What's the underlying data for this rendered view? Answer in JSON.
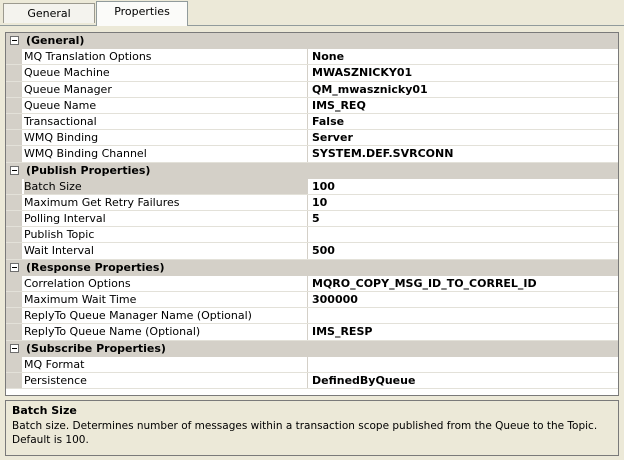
{
  "tabs": [
    {
      "label": "General"
    },
    {
      "label": "Properties"
    }
  ],
  "sections": [
    {
      "title": "(General)",
      "props": [
        {
          "name": "MQ Translation Options",
          "value": "None"
        },
        {
          "name": "Queue Machine",
          "value": "MWASZNICKY01"
        },
        {
          "name": "Queue Manager",
          "value": "QM_mwasznicky01"
        },
        {
          "name": "Queue Name",
          "value": "IMS_REQ"
        },
        {
          "name": "Transactional",
          "value": "False"
        },
        {
          "name": "WMQ Binding",
          "value": "Server"
        },
        {
          "name": "WMQ Binding Channel",
          "value": "SYSTEM.DEF.SVRCONN"
        }
      ]
    },
    {
      "title": "(Publish Properties)",
      "props": [
        {
          "name": "Batch Size",
          "value": "100"
        },
        {
          "name": "Maximum Get Retry Failures",
          "value": "10"
        },
        {
          "name": "Polling Interval",
          "value": "5"
        },
        {
          "name": "Publish Topic",
          "value": ""
        },
        {
          "name": "Wait Interval",
          "value": "500"
        }
      ]
    },
    {
      "title": "(Response Properties)",
      "props": [
        {
          "name": "Correlation Options",
          "value": "MQRO_COPY_MSG_ID_TO_CORREL_ID"
        },
        {
          "name": "Maximum Wait Time",
          "value": "300000"
        },
        {
          "name": "ReplyTo Queue Manager Name (Optional)",
          "value": ""
        },
        {
          "name": "ReplyTo Queue Name (Optional)",
          "value": "IMS_RESP"
        }
      ]
    },
    {
      "title": "(Subscribe Properties)",
      "props": [
        {
          "name": "MQ Format",
          "value": ""
        },
        {
          "name": "Persistence",
          "value": "DefinedByQueue"
        }
      ]
    }
  ],
  "description": {
    "title": "Batch Size",
    "text": "Batch size. Determines number of messages within a transaction scope published from the Queue to the Topic. Default is 100."
  }
}
